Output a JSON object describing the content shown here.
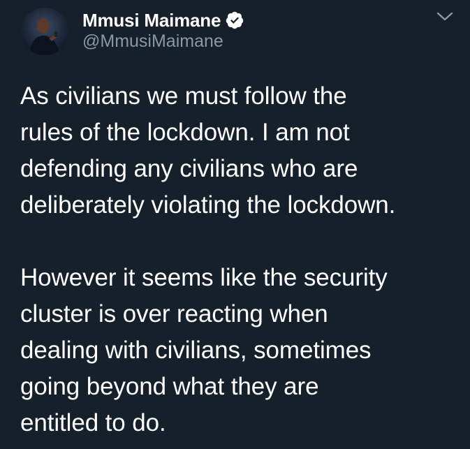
{
  "tweet": {
    "display_name": "Mmusi Maimane",
    "handle": "@MmusiMaimane",
    "verified_icon": "verified-badge-icon",
    "menu_icon": "chevron-down-icon",
    "paragraphs": [
      {
        "lines": [
          "As civilians we must follow the",
          "rules of the lockdown. I am not",
          "defending any civilians who are",
          "deliberately violating the lockdown."
        ]
      },
      {
        "lines": [
          "However it seems like the security",
          "cluster is over reacting when",
          "dealing with civilians, sometimes",
          "going beyond what they are",
          "entitled to do."
        ]
      }
    ]
  },
  "colors": {
    "background": "#15202b",
    "primary_text": "#ffffff",
    "secondary_text": "#8899a6"
  }
}
